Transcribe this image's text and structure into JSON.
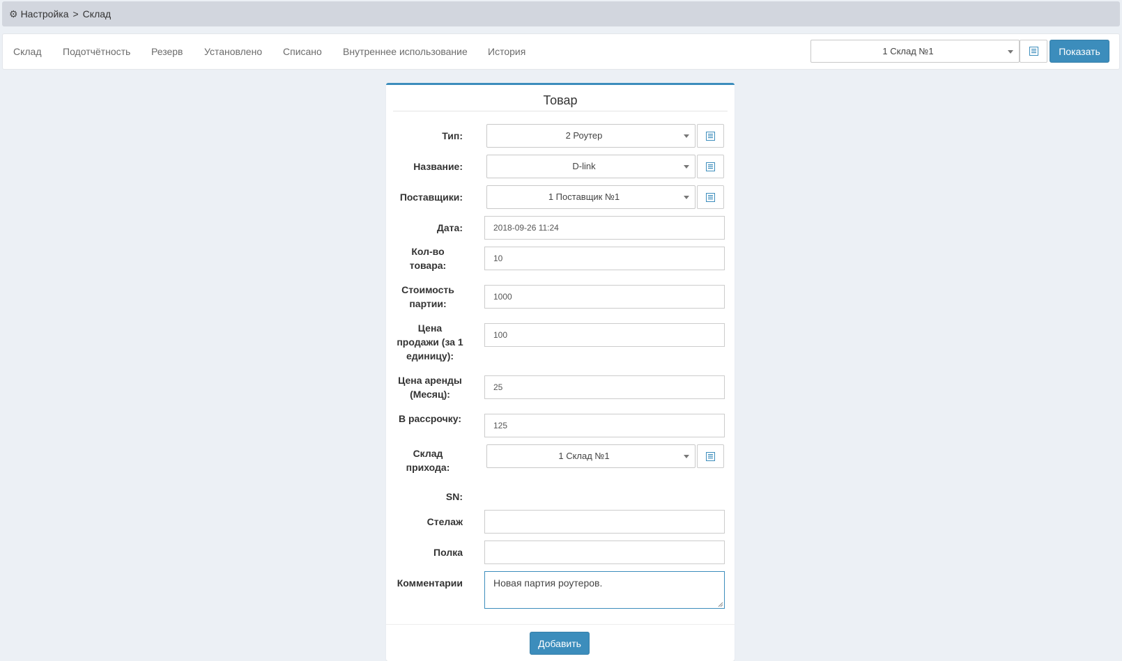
{
  "breadcrumb": {
    "icon": "gear-icon",
    "parent": "Настройка",
    "separator": ">",
    "current": "Склад"
  },
  "tabs": [
    {
      "label": "Склад"
    },
    {
      "label": "Подотчётность"
    },
    {
      "label": "Резерв"
    },
    {
      "label": "Установлено"
    },
    {
      "label": "Списано"
    },
    {
      "label": "Внутреннее использование"
    },
    {
      "label": "История"
    }
  ],
  "warehouse_filter": {
    "selected": "1 Склад №1",
    "show_label": "Показать"
  },
  "form": {
    "title": "Товар",
    "type": {
      "label": "Тип:",
      "value": "2 Роутер"
    },
    "name": {
      "label": "Название:",
      "value": "D-link"
    },
    "suppliers": {
      "label": "Поставщики:",
      "value": "1 Поставщик №1"
    },
    "date": {
      "label": "Дата:",
      "value": "2018-09-26 11:24"
    },
    "quantity": {
      "label_line1": "Кол-во",
      "label_line2": "товара:",
      "value": "10"
    },
    "batch_cost": {
      "label_line1": "Стоимость",
      "label_line2": "партии:",
      "value": "1000"
    },
    "sale_price": {
      "label_line1": "Цена",
      "label_line2": "продажи (за 1",
      "label_line3": "единицу):",
      "value": "100"
    },
    "rent_price": {
      "label_line1": "Цена аренды",
      "label_line2": "(Месяц):",
      "value": "25"
    },
    "installment": {
      "label": "В рассрочку:",
      "value": "125"
    },
    "arrival_warehouse": {
      "label_line1": "Склад",
      "label_line2": "прихода:",
      "value": "1 Склад №1"
    },
    "sn": {
      "label": "SN:"
    },
    "rack": {
      "label": "Стелаж",
      "value": ""
    },
    "shelf": {
      "label": "Полка",
      "value": ""
    },
    "comments": {
      "label": "Комментарии",
      "value": "Новая партия роутеров."
    },
    "submit_label": "Добавить"
  },
  "colors": {
    "accent": "#3c8dbc",
    "page_bg": "#ecf0f5",
    "breadcrumb_bg": "#d2d6de"
  }
}
